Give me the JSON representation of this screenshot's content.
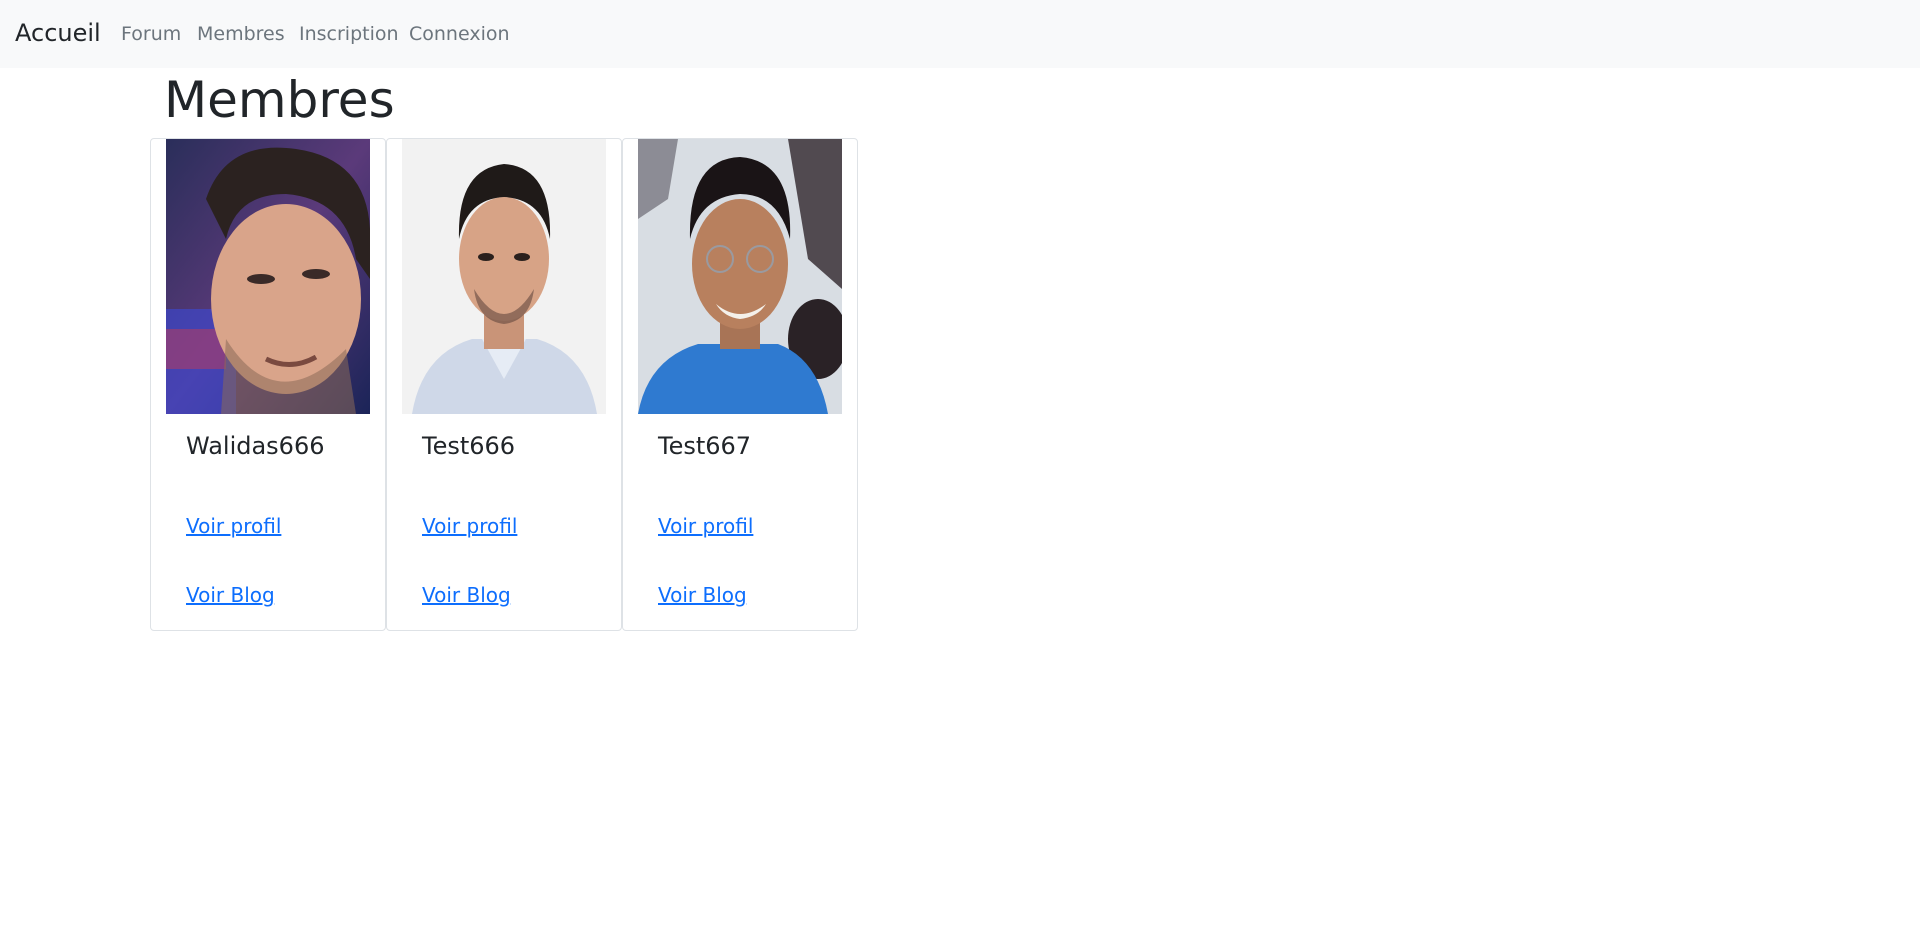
{
  "navbar": {
    "brand": "Accueil",
    "links": [
      "Forum",
      "Membres",
      "Inscription",
      "Connexion"
    ]
  },
  "page": {
    "title": "Membres"
  },
  "members": [
    {
      "name": "Walidas666",
      "profile_label": "Voir profil",
      "blog_label": "Voir Blog"
    },
    {
      "name": "Test666",
      "profile_label": "Voir profil",
      "blog_label": "Voir Blog"
    },
    {
      "name": "Test667",
      "profile_label": "Voir profil",
      "blog_label": "Voir Blog"
    }
  ],
  "colors": {
    "navbar_bg": "#f8f9fa",
    "link": "#0d6efd",
    "nav_link": "#6c757d",
    "text": "#212529",
    "card_border": "#dee2e6"
  }
}
